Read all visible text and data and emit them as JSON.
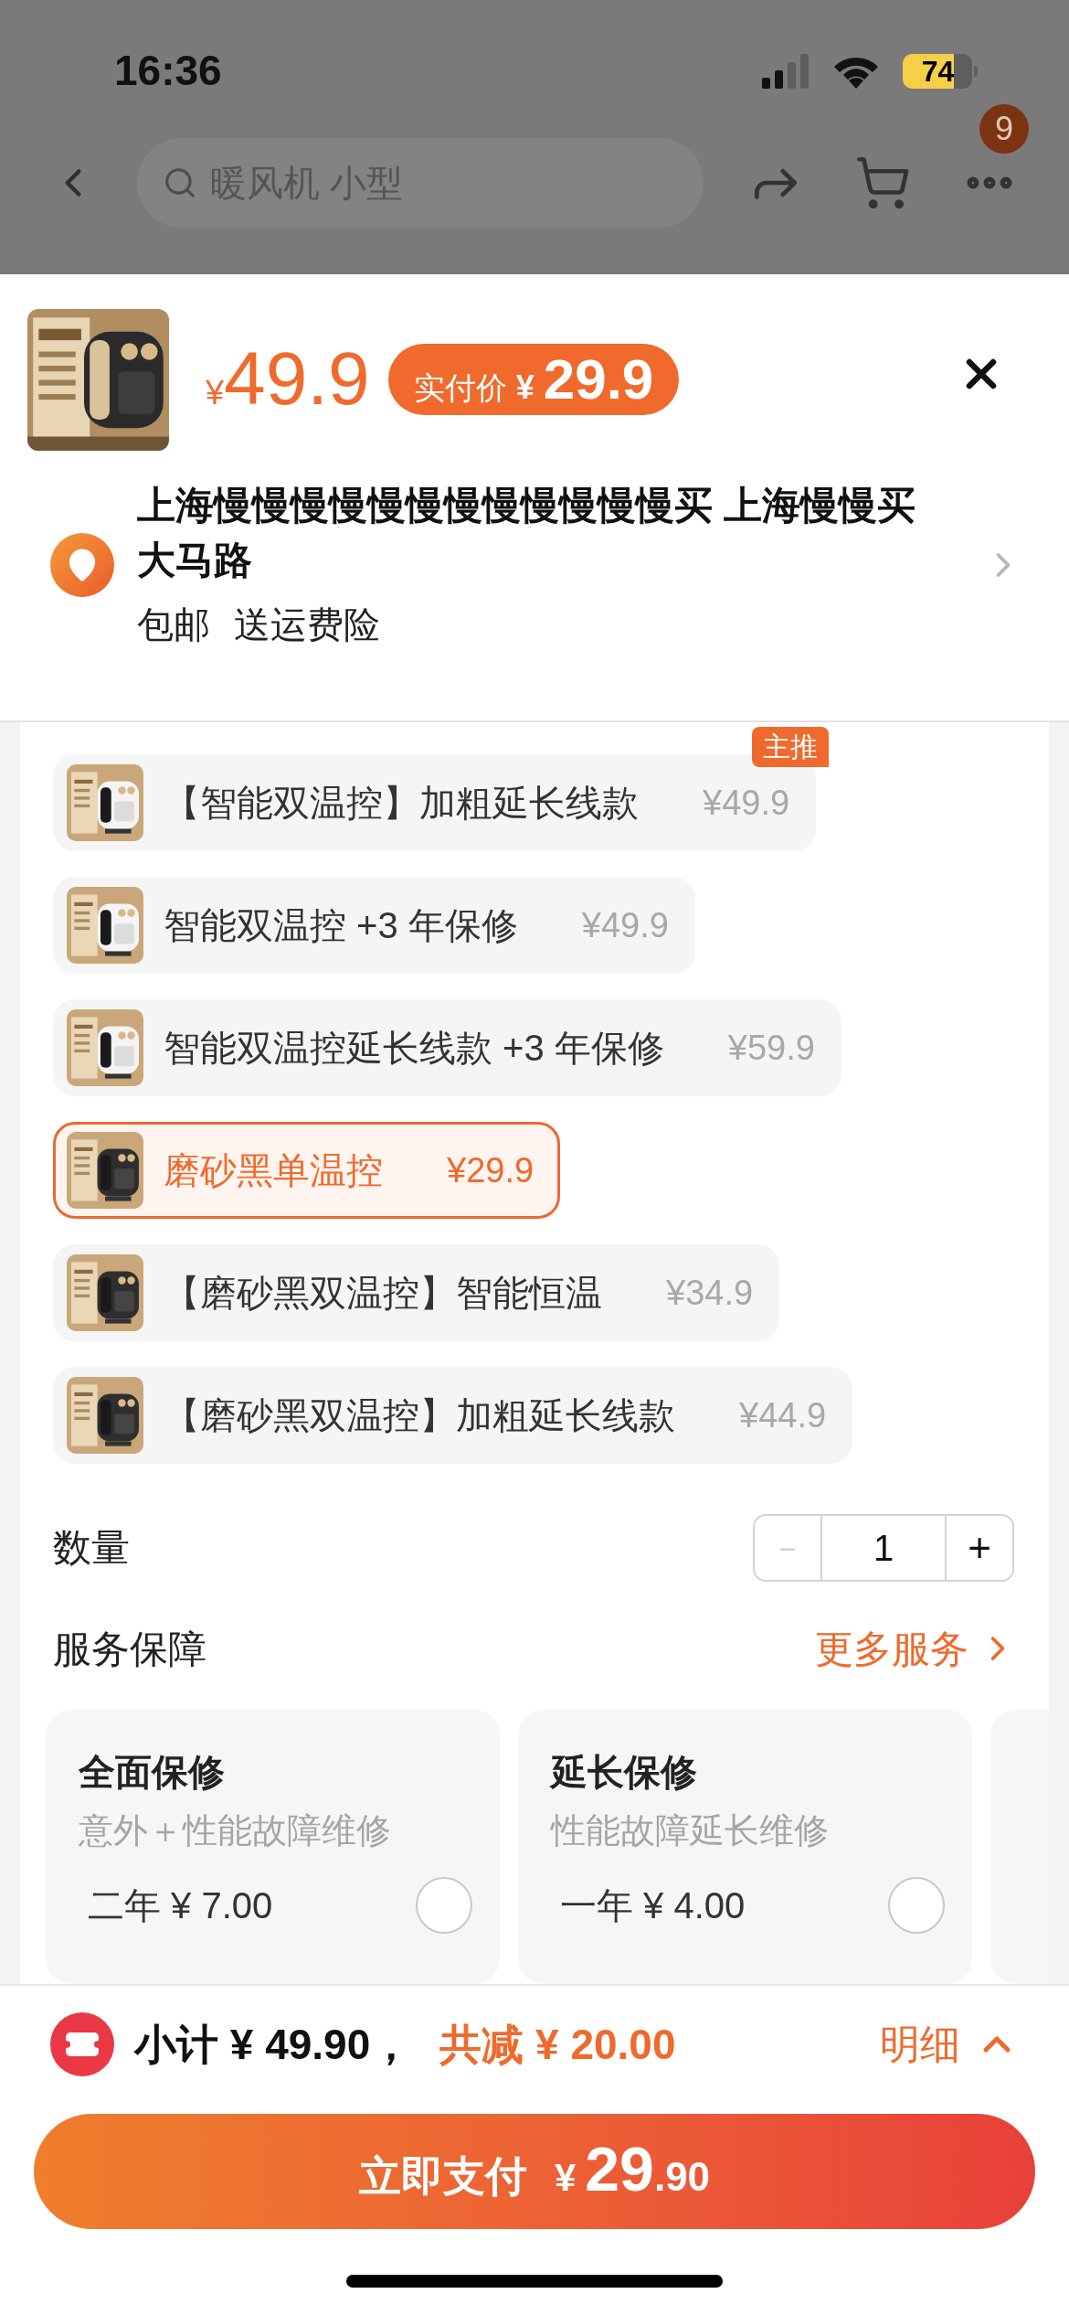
{
  "status_bar": {
    "time": "16:36",
    "battery": "74"
  },
  "nav": {
    "search": {
      "placeholder": "暖风机 小型"
    },
    "badge": "9"
  },
  "header": {
    "price_currency": "¥",
    "price": "49.9",
    "paid_badge": {
      "label": "实付价",
      "currency": "¥",
      "amount": "29.9"
    }
  },
  "address": {
    "line": "上海慢慢慢慢慢慢慢慢慢慢慢慢买 上海慢慢买大马路",
    "tags": [
      "包邮",
      "送运费险"
    ]
  },
  "options": [
    {
      "label": "【智能双温控】加粗延长线款",
      "price": "¥49.9",
      "selected": false,
      "tag": "主推"
    },
    {
      "label": "智能双温控 +3 年保修",
      "price": "¥49.9",
      "selected": false
    },
    {
      "label": "智能双温控延长线款 +3 年保修",
      "price": "¥59.9",
      "selected": false
    },
    {
      "label": "磨砂黑单温控",
      "price": "¥29.9",
      "selected": true
    },
    {
      "label": "【磨砂黑双温控】智能恒温",
      "price": "¥34.9",
      "selected": false
    },
    {
      "label": "【磨砂黑双温控】加粗延长线款",
      "price": "¥44.9",
      "selected": false
    }
  ],
  "quantity": {
    "label": "数量",
    "minus": "－",
    "value": "1",
    "plus": "+",
    "minus_disabled": true
  },
  "services": {
    "title": "服务保障",
    "more": "更多服务",
    "cards": [
      {
        "title": "全面保修",
        "subtitle": "意外＋性能故障维修",
        "option": "二年 ¥ 7.00",
        "selected": false
      },
      {
        "title": "延长保修",
        "subtitle": "性能故障延长维修",
        "option": "一年 ¥ 4.00",
        "selected": false
      }
    ]
  },
  "footer": {
    "subtotal": "小计 ¥ 49.90，",
    "discount": "共减 ¥ 20.00",
    "details": "明细",
    "pay": {
      "label": "立即支付",
      "currency": "¥",
      "amount": "29",
      "decimals": ".90"
    }
  }
}
